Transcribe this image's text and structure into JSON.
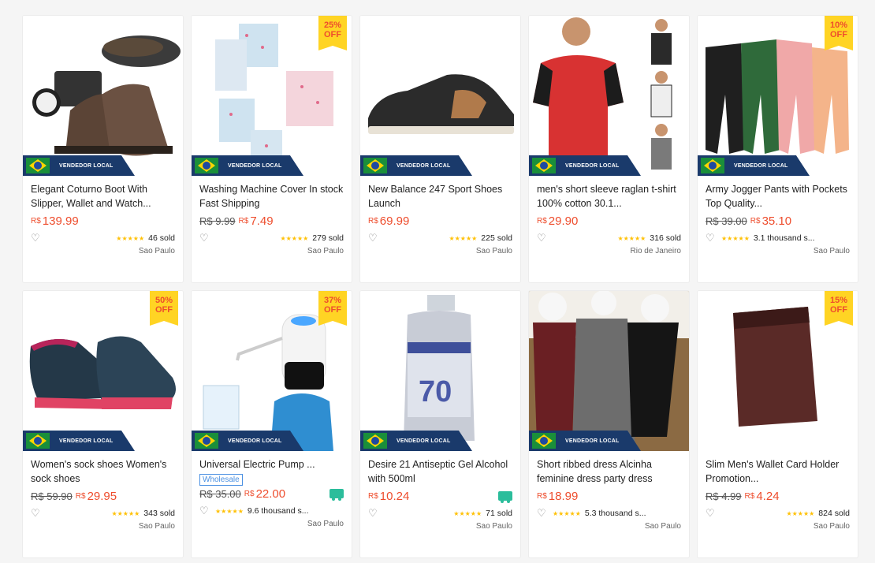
{
  "badge_local": "VENDEDOR LOCAL",
  "products": [
    {
      "title": "Elegant Coturno Boot With Slipper, Wallet and Watch...",
      "currency": "R$",
      "price": "139.99",
      "old_price": "",
      "discount": "",
      "sold": "46 sold",
      "location": "Sao Paulo",
      "wholesale": "",
      "truck": false,
      "image": "boot-set"
    },
    {
      "title": "Washing Machine Cover In stock Fast Shipping",
      "currency": "R$",
      "price": "7.49",
      "old_price": "R$ 9.99",
      "discount": "25% OFF",
      "sold": "279 sold",
      "location": "Sao Paulo",
      "wholesale": "",
      "truck": false,
      "image": "machine-cover"
    },
    {
      "title": "New Balance 247 Sport Shoes Launch",
      "currency": "R$",
      "price": "69.99",
      "old_price": "",
      "discount": "",
      "sold": "225 sold",
      "location": "Sao Paulo",
      "wholesale": "",
      "truck": false,
      "image": "sneaker"
    },
    {
      "title": "men's short sleeve raglan t-shirt 100% cotton 30.1...",
      "currency": "R$",
      "price": "29.90",
      "old_price": "",
      "discount": "",
      "sold": "316 sold",
      "location": "Rio de Janeiro",
      "wholesale": "",
      "truck": false,
      "image": "tshirt"
    },
    {
      "title": "Army Jogger Pants with Pockets Top Quality...",
      "currency": "R$",
      "price": "35.10",
      "old_price": "R$ 39.00",
      "discount": "10% OFF",
      "sold": "3.1 thousand s...",
      "location": "Sao Paulo",
      "wholesale": "",
      "truck": false,
      "image": "joggers"
    },
    {
      "title": "Women's sock shoes Women's sock shoes",
      "currency": "R$",
      "price": "29.95",
      "old_price": "R$ 59.90",
      "discount": "50% OFF",
      "sold": "343 sold",
      "location": "Sao Paulo",
      "wholesale": "",
      "truck": false,
      "image": "sock-shoes"
    },
    {
      "title": "Universal Electric Pump ...",
      "currency": "R$",
      "price": "22.00",
      "old_price": "R$ 35.00",
      "discount": "37% OFF",
      "sold": "9.6 thousand s...",
      "location": "Sao Paulo",
      "wholesale": "Wholesale",
      "truck": true,
      "image": "water-pump"
    },
    {
      "title": "Desire 21 Antiseptic Gel Alcohol with 500ml",
      "currency": "R$",
      "price": "10.24",
      "old_price": "",
      "discount": "",
      "sold": "71 sold",
      "location": "Sao Paulo",
      "wholesale": "",
      "truck": true,
      "image": "alcohol-gel"
    },
    {
      "title": "Short ribbed dress Alcinha feminine dress party dress",
      "currency": "R$",
      "price": "18.99",
      "old_price": "",
      "discount": "",
      "sold": "5.3 thousand s...",
      "location": "Sao Paulo",
      "wholesale": "",
      "truck": false,
      "image": "dresses"
    },
    {
      "title": "Slim Men's Wallet Card Holder Promotion...",
      "currency": "R$",
      "price": "4.24",
      "old_price": "R$ 4.99",
      "discount": "15% OFF",
      "sold": "824 sold",
      "location": "Sao Paulo",
      "wholesale": "",
      "truck": false,
      "image": "wallet"
    }
  ]
}
